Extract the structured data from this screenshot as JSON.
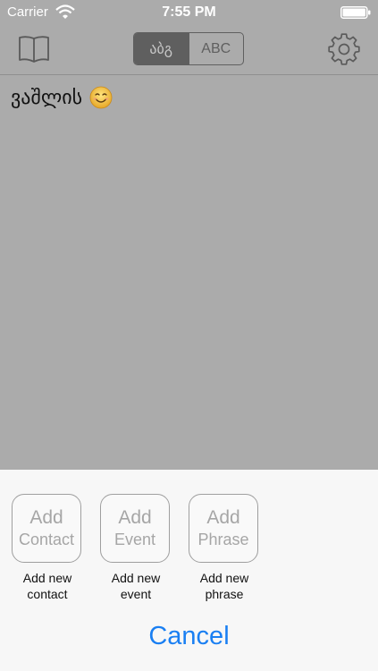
{
  "status_bar": {
    "carrier": "Carrier",
    "time": "7:55 PM"
  },
  "navbar": {
    "left_icon": "book-icon",
    "right_icon": "gear-icon",
    "segments": [
      {
        "label": "აბგ",
        "selected": true
      },
      {
        "label": "ABC",
        "selected": false
      }
    ]
  },
  "content": {
    "text": "ვაშლის",
    "emoji_icon": "smiling-face-icon"
  },
  "action_sheet": {
    "actions": [
      {
        "tile_top": "Add",
        "tile_bottom": "Contact",
        "caption": "Add new contact"
      },
      {
        "tile_top": "Add",
        "tile_bottom": "Event",
        "caption": "Add new event"
      },
      {
        "tile_top": "Add",
        "tile_bottom": "Phrase",
        "caption": "Add new phrase"
      }
    ],
    "cancel_label": "Cancel"
  },
  "colors": {
    "accent": "#1a7ff2",
    "background": "#ababab",
    "sheet": "#f7f7f7"
  }
}
